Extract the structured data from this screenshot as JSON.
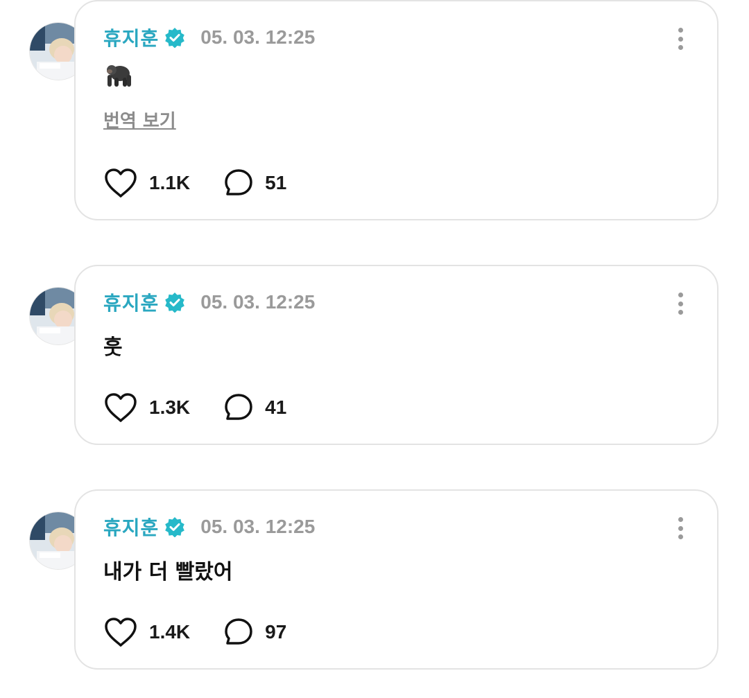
{
  "colors": {
    "author": "#2aa7c0",
    "verified": "#26b9c9",
    "muted": "#9a9a9a",
    "border": "#e3e3e3"
  },
  "posts": [
    {
      "author": "휴지훈",
      "time": "05. 03. 12:25",
      "emoji_icon": "gorilla-emoji",
      "translate_label": "번역 보기",
      "likes": "1.1K",
      "comments": "51"
    },
    {
      "author": "휴지훈",
      "time": "05. 03. 12:25",
      "text": "훗",
      "likes": "1.3K",
      "comments": "41"
    },
    {
      "author": "휴지훈",
      "time": "05. 03. 12:25",
      "text": "내가 더 빨랐어",
      "likes": "1.4K",
      "comments": "97"
    }
  ]
}
